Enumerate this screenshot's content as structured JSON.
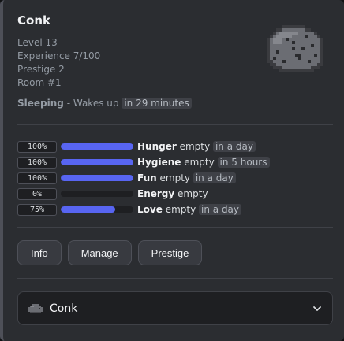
{
  "pet": {
    "name": "Conk",
    "level": "Level 13",
    "experience": "Experience 7/100",
    "prestige": "Prestige 2",
    "room": "Room #1",
    "state": "Sleeping",
    "state_detail": "- Wakes up",
    "state_time": "in 29 minutes"
  },
  "needs": [
    {
      "percent": "100%",
      "level": 1.0,
      "name": "Hunger",
      "suffix": "empty",
      "time": "in a day"
    },
    {
      "percent": "100%",
      "level": 1.0,
      "name": "Hygiene",
      "suffix": "empty",
      "time": "in 5 hours"
    },
    {
      "percent": "100%",
      "level": 1.0,
      "name": "Fun",
      "suffix": "empty",
      "time": "in a day"
    },
    {
      "percent": "0%",
      "level": 0.0,
      "name": "Energy",
      "suffix": "empty",
      "time": ""
    },
    {
      "percent": "75%",
      "level": 0.75,
      "name": "Love",
      "suffix": "empty",
      "time": "in a day"
    }
  ],
  "buttons": {
    "info": "Info",
    "manage": "Manage",
    "prestige": "Prestige"
  },
  "select": {
    "selected": "Conk",
    "icon": "rock-pet-icon"
  },
  "colors": {
    "accent": "#5865f2",
    "background": "#2b2d31"
  }
}
